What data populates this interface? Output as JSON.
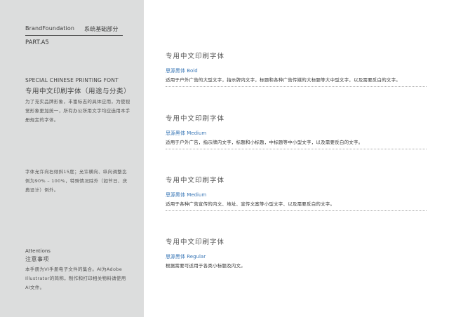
{
  "sidebar": {
    "brand": "BrandFoundation",
    "section": "系统基础部分",
    "part": "PART.A5",
    "font_title_en": "SPECIAL CHINESE PRINTING FONT",
    "font_title_zh": "专用中文印刷字体（用途与分类）",
    "paragraph1": "为了充实品牌形象，丰富标志的具体应用，为使视觉形象更加统一，所有办公所用文字均应选用本手册规定的字体。",
    "paragraph2": "字体允许向右倾斜15度；允许横向、纵向调整比例为90% – 100%，特殊情况除外（如节日、庆典设计）例外。",
    "attention_en": "Attentions",
    "attention_zh": "注意事项",
    "paragraph3": "本手册为VI手册电子文件的集合。AI为Adobe Illustrator的简称，制作和打印相关物料请使用AI文件。"
  },
  "blocks": [
    {
      "heading": "专用中文印刷字体",
      "weight": "思源黑体 Bold",
      "desc": "适用于户外广告的大型文字，指示牌内文字，标题和各种广告传媒的大标题等大中型文字，以及需要反白的文字。"
    },
    {
      "heading": "专用中文印刷字体",
      "weight": "思源黑体 Medium",
      "desc": "适用于户外广告，指示牌内文字，标题和小标题，中标题等中小型文字，以及需要反白的文字。"
    },
    {
      "heading": "专用中文印刷字体",
      "weight": "思源黑体 Medium",
      "desc": "适用于各种广告宣传的内文、地址、宣传文案等小型文字、以及需要反白的文字。"
    },
    {
      "heading": "专用中文印刷字体",
      "weight": "思源黑体 Regular",
      "desc": "根据需要可适用于各类小标题及内文。"
    }
  ]
}
